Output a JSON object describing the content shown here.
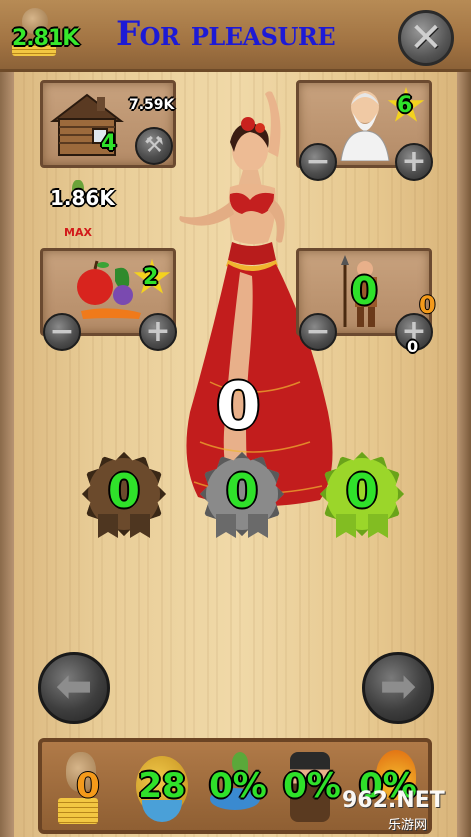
{
  "header": {
    "money": "2.81K",
    "title": "For pleasure",
    "close_icon": "close-x-icon"
  },
  "house_panel": {
    "icon": "log-cabin-icon",
    "level": "4",
    "cost": "7.59K",
    "action_icon": "hammer-icon"
  },
  "income": {
    "value": "1.86K",
    "max_label": "MAX"
  },
  "sage_panel": {
    "icon": "old-sage-icon",
    "count": "6",
    "minus": "−",
    "plus": "+"
  },
  "food_panel": {
    "icon": "fruit-vegetables-icon",
    "count": "2",
    "minus": "−",
    "plus": "+"
  },
  "guard_panel": {
    "icon": "spear-guard-icon",
    "count": "0",
    "cost": "0",
    "sub": "0",
    "minus": "−",
    "plus": "+"
  },
  "center_counter": "0",
  "rosettes": [
    {
      "name": "bronze",
      "value": "0",
      "color": "#6b4a2c",
      "inner": "#7a5634"
    },
    {
      "name": "silver",
      "value": "0",
      "color": "#8a8a8a",
      "inner": "#9e9e9e"
    },
    {
      "name": "gold",
      "value": "0",
      "color": "#9bd62a",
      "inner": "#b2e63a"
    }
  ],
  "nav": {
    "left_icon": "arrow-left-icon",
    "right_icon": "arrow-right-icon"
  },
  "bottom_bar": {
    "coins": "0",
    "population": "28",
    "stat1": "0%",
    "stat2": "0%",
    "stat3": "0%"
  },
  "watermark": {
    "text": "962.NET",
    "sub": "乐游网"
  }
}
